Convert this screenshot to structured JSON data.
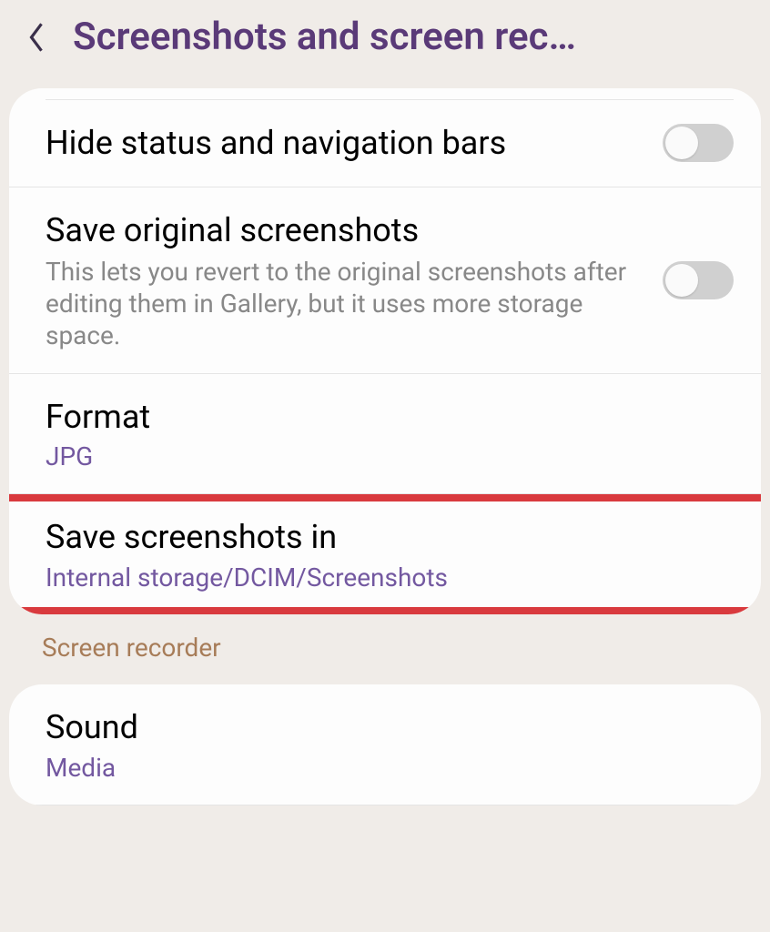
{
  "header": {
    "title": "Screenshots and screen rec…"
  },
  "settings": {
    "hideStatus": {
      "title": "Hide status and navigation bars"
    },
    "saveOriginal": {
      "title": "Save original screenshots",
      "description": "This lets you revert to the original screenshots after editing them in Gallery, but it uses more storage space."
    },
    "format": {
      "title": "Format",
      "value": "JPG"
    },
    "saveLocation": {
      "title": "Save screenshots in",
      "value": "Internal storage/DCIM/Screenshots"
    }
  },
  "sections": {
    "recorder": "Screen recorder"
  },
  "recorderSettings": {
    "sound": {
      "title": "Sound",
      "value": "Media"
    }
  }
}
